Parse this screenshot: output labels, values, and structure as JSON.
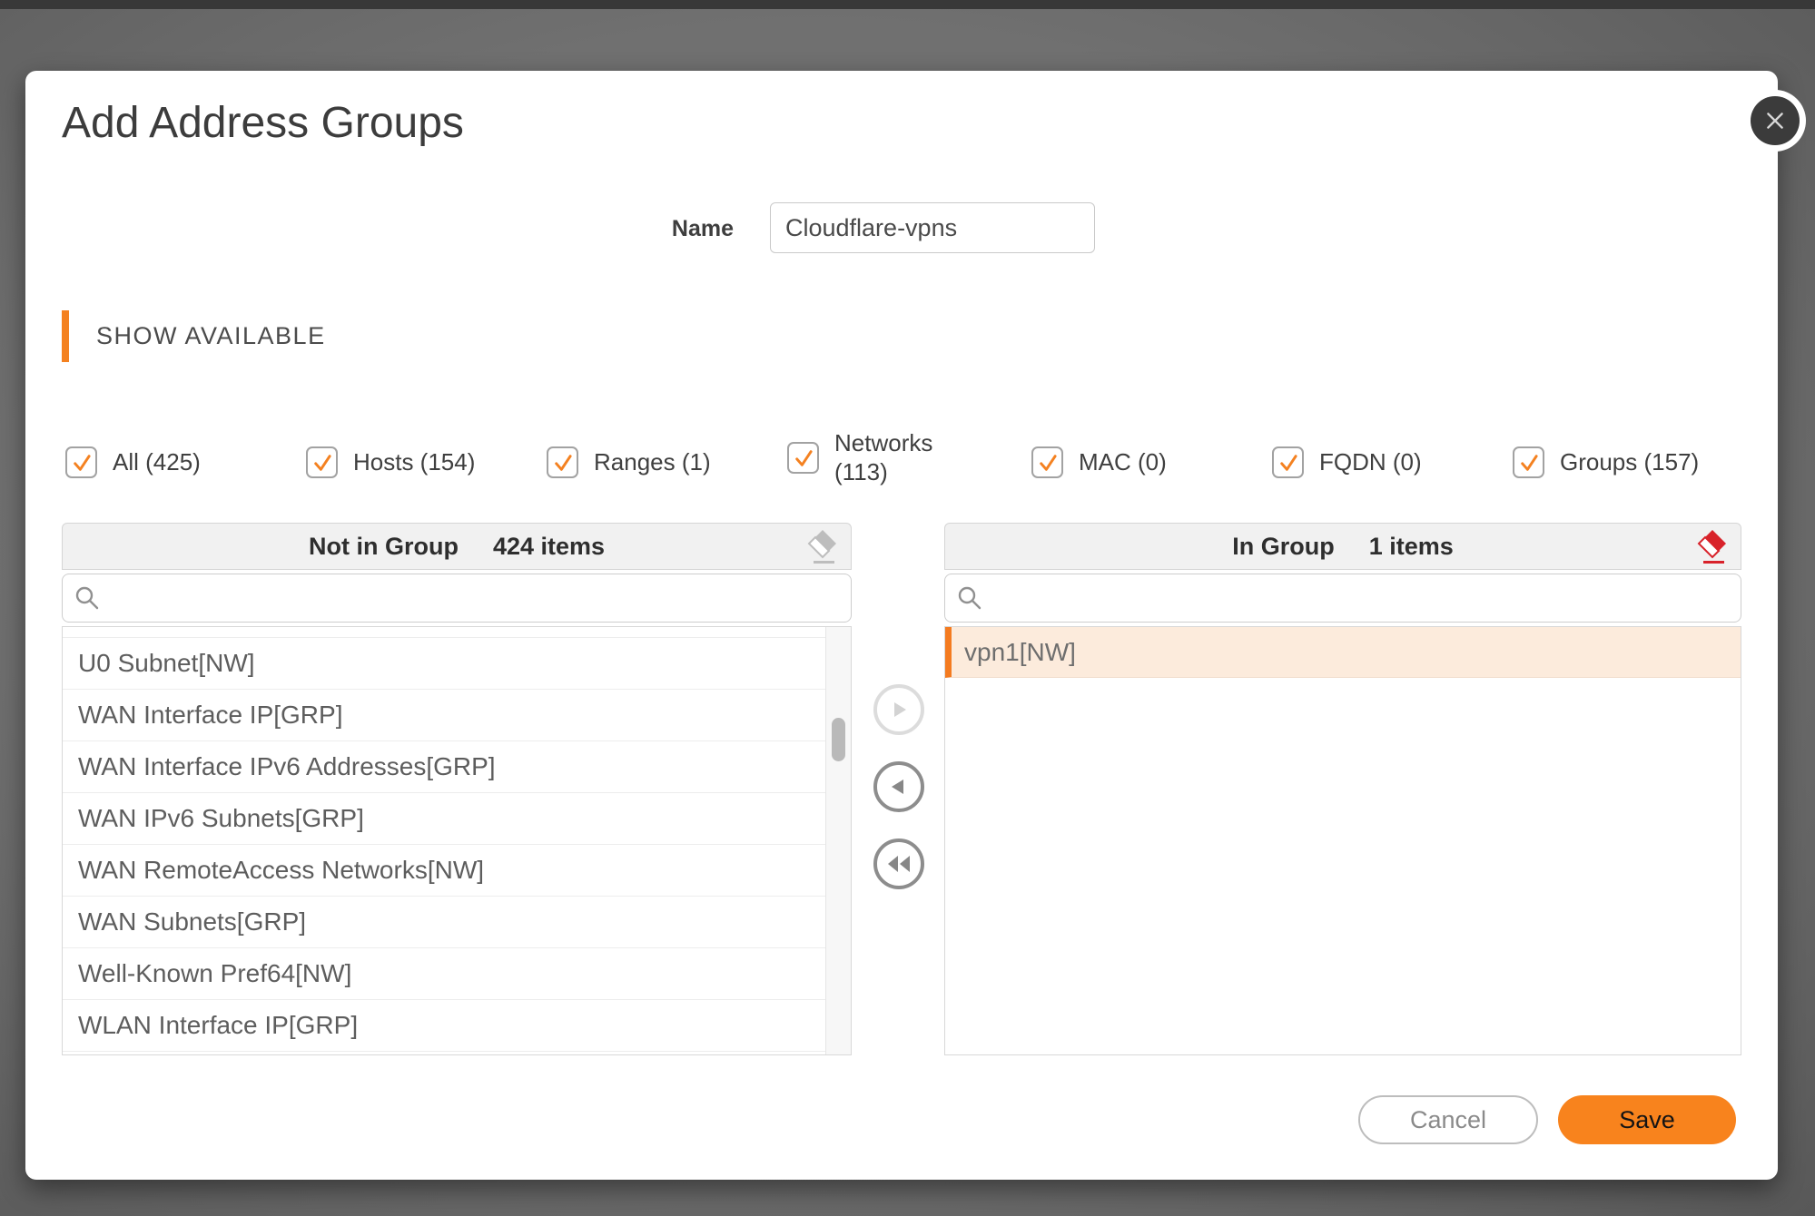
{
  "dialog": {
    "title": "Add Address Groups",
    "name": {
      "label": "Name",
      "value": "Cloudflare-vpns",
      "placeholder": ""
    },
    "section": {
      "label": "SHOW AVAILABLE"
    },
    "filters": [
      {
        "label": "All (425)",
        "checked": true
      },
      {
        "label": "Hosts (154)",
        "checked": true
      },
      {
        "label": "Ranges (1)",
        "checked": true
      },
      {
        "label": "Networks (113)",
        "checked": true,
        "wrap": true
      },
      {
        "label": "MAC (0)",
        "checked": true
      },
      {
        "label": "FQDN (0)",
        "checked": true
      },
      {
        "label": "Groups (157)",
        "checked": true
      }
    ],
    "left_panel": {
      "title": "Not in Group",
      "count": "424 items",
      "search": {
        "value": "",
        "placeholder": ""
      },
      "items": [
        "U0 Subnet[NW]",
        "WAN Interface IP[GRP]",
        "WAN Interface IPv6 Addresses[GRP]",
        "WAN IPv6 Subnets[GRP]",
        "WAN RemoteAccess Networks[NW]",
        "WAN Subnets[GRP]",
        "Well-Known Pref64[NW]",
        "WLAN Interface IP[GRP]"
      ]
    },
    "right_panel": {
      "title": "In Group",
      "count": "1 items",
      "search": {
        "value": "",
        "placeholder": ""
      },
      "items": [
        {
          "label": "vpn1[NW]",
          "selected": true
        }
      ]
    },
    "footer": {
      "cancel_label": "Cancel",
      "save_label": "Save"
    }
  },
  "colors": {
    "accent_orange": "#F48120",
    "save_button": "#F8831D",
    "selected_row_bg": "#FCEBDC",
    "selected_row_bar": "#F47B20",
    "eraser_red": "#D8222A",
    "eraser_gray": "#BDBDBD",
    "backdrop": "#6B6B6B"
  }
}
